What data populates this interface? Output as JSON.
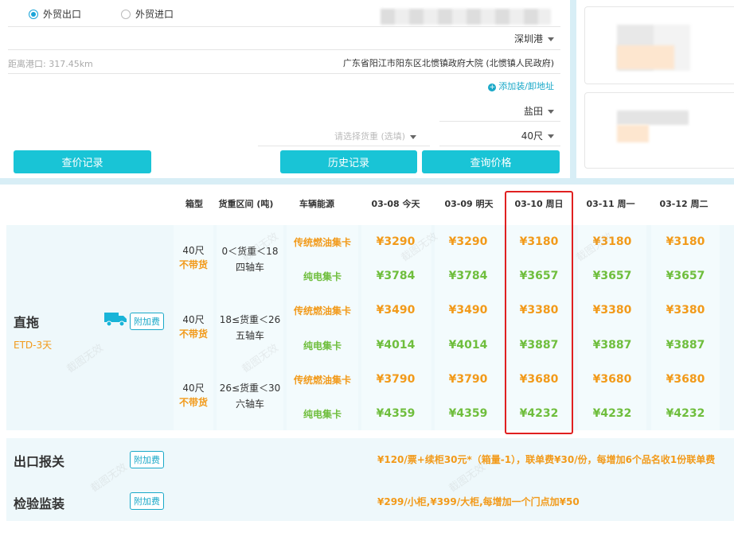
{
  "form": {
    "export_label": "外贸出口",
    "import_label": "外贸进口",
    "port": "深圳港",
    "distance": "距离港口: 317.45km",
    "address": "广东省阳江市阳东区北惯镇政府大院 (北惯镇人民政府)",
    "add_address": "添加装/卸地址",
    "terminal": "盐田",
    "cargo_placeholder": "请选择货重 (选填)",
    "box_size": "40尺",
    "btn_history_query": "查价记录",
    "btn_history": "历史记录",
    "btn_query": "查询价格"
  },
  "table": {
    "headers": [
      "箱型",
      "货重区间 (吨)",
      "车辆能源",
      "03-08 今天",
      "03-09 明天",
      "03-10 周日",
      "03-11 周一",
      "03-12 周二"
    ],
    "service_name": "直拖",
    "etd": "ETD-3天",
    "surcharge_tag": "附加费",
    "groups": [
      {
        "box": "40尺",
        "no_goods": "不带货",
        "range_line1": "0＜货重＜18",
        "range_line2": "四轴车",
        "rows": [
          {
            "energy": "传统燃油集卡",
            "energy_color": "#f29a1a",
            "prices": [
              "¥3290",
              "¥3290",
              "¥3180",
              "¥3180",
              "¥3180"
            ]
          },
          {
            "energy": "纯电集卡",
            "energy_color": "#6fbe3d",
            "prices": [
              "¥3784",
              "¥3784",
              "¥3657",
              "¥3657",
              "¥3657"
            ]
          }
        ]
      },
      {
        "box": "40尺",
        "no_goods": "不带货",
        "range_line1": "18≤货重＜26",
        "range_line2": "五轴车",
        "rows": [
          {
            "energy": "传统燃油集卡",
            "energy_color": "#f29a1a",
            "prices": [
              "¥3490",
              "¥3490",
              "¥3380",
              "¥3380",
              "¥3380"
            ]
          },
          {
            "energy": "纯电集卡",
            "energy_color": "#6fbe3d",
            "prices": [
              "¥4014",
              "¥4014",
              "¥3887",
              "¥3887",
              "¥3887"
            ]
          }
        ]
      },
      {
        "box": "40尺",
        "no_goods": "不带货",
        "range_line1": "26≤货重＜30",
        "range_line2": "六轴车",
        "rows": [
          {
            "energy": "传统燃油集卡",
            "energy_color": "#f29a1a",
            "prices": [
              "¥3790",
              "¥3790",
              "¥3680",
              "¥3680",
              "¥3680"
            ]
          },
          {
            "energy": "纯电集卡",
            "energy_color": "#6fbe3d",
            "prices": [
              "¥4359",
              "¥4359",
              "¥4232",
              "¥4232",
              "¥4232"
            ]
          }
        ]
      }
    ]
  },
  "services": [
    {
      "name": "出口报关",
      "tag": "附加费",
      "desc": "¥120/票+续柜30元*（箱量-1），联单费¥30/份，每增加6个品名收1份联单费"
    },
    {
      "name": "检验监装",
      "tag": "附加费",
      "desc": "¥299/小柜,¥399/大柜,每增加一个门点加¥50"
    }
  ],
  "colors": {
    "accent": "#19c4d6",
    "orange": "#f29a1a",
    "green": "#6fbe3d",
    "highlight": "#e02020"
  },
  "watermark_text": "截图无效"
}
